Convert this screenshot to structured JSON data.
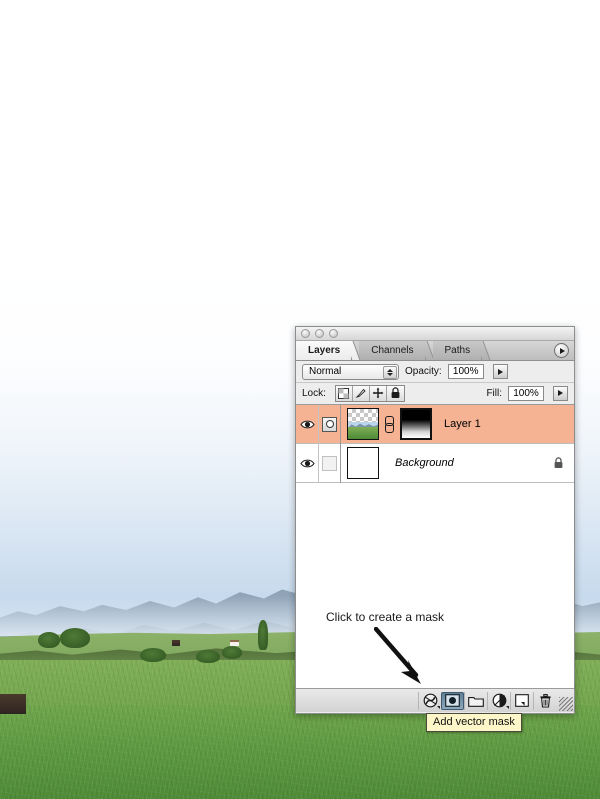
{
  "photo": {
    "description": "Alpine meadow landscape with distant mountain range under a white-to-blue gradient sky"
  },
  "panel": {
    "titlebar": {
      "buttons": [
        "close-dot",
        "minimize-dot",
        "zoom-dot"
      ]
    },
    "tabs": [
      {
        "label": "Layers",
        "active": true
      },
      {
        "label": "Channels",
        "active": false
      },
      {
        "label": "Paths",
        "active": false
      }
    ],
    "menu_button_icon": "panel-menu-triangle-icon",
    "options": {
      "blend_mode": "Normal",
      "opacity_label": "Opacity:",
      "opacity_value": "100%",
      "fill_label": "Fill:",
      "fill_value": "100%",
      "lock_label": "Lock:",
      "lock_buttons": [
        {
          "icon": "lock-transparent-pixels-icon"
        },
        {
          "icon": "lock-image-pixels-brush-icon"
        },
        {
          "icon": "lock-position-move-icon"
        },
        {
          "icon": "lock-all-padlock-icon"
        }
      ]
    },
    "layers": [
      {
        "name": "Layer 1",
        "selected": true,
        "italic": false,
        "visible": true,
        "has_mask_indicator": true,
        "has_link": true,
        "has_mask_thumb": true,
        "locked": false
      },
      {
        "name": "Background",
        "selected": false,
        "italic": true,
        "visible": true,
        "has_mask_indicator": false,
        "has_link": false,
        "has_mask_thumb": false,
        "locked": true
      }
    ],
    "annotation": {
      "text": "Click to create a mask",
      "arrow_icon": "arrow-down-right-icon"
    },
    "bottom_buttons": [
      {
        "icon": "layer-style-fx-icon",
        "pressed": false,
        "has_caret": true
      },
      {
        "icon": "add-layer-mask-icon",
        "pressed": true,
        "has_caret": false
      },
      {
        "icon": "new-group-folder-icon",
        "pressed": false,
        "has_caret": false
      },
      {
        "icon": "new-adjustment-layer-icon",
        "pressed": false,
        "has_caret": true
      },
      {
        "icon": "new-layer-icon",
        "pressed": false,
        "has_caret": false
      },
      {
        "icon": "delete-layer-trash-icon",
        "pressed": false,
        "has_caret": false
      }
    ],
    "resize_grip_icon": "resize-grip-icon"
  },
  "tooltip": {
    "text": "Add vector mask"
  },
  "colors": {
    "selected_layer": "#f5b394",
    "panel_bg": "#ededed",
    "tooltip_bg": "#fdf6c8",
    "pressed_button": "#5f7f96"
  }
}
